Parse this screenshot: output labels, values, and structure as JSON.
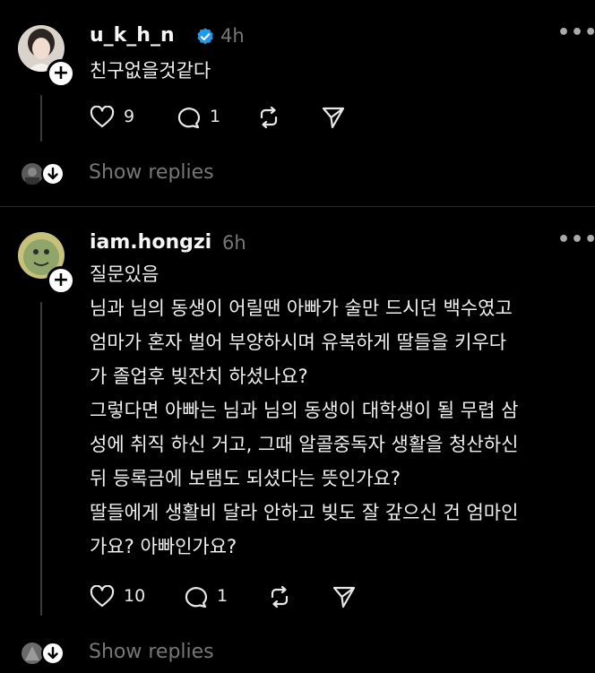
{
  "comments": [
    {
      "username": "u_k_h_n",
      "verified": true,
      "time": "4h",
      "lines": [
        "친구없을것같다"
      ],
      "likes": "9",
      "replies": "1",
      "show_replies": "Show replies"
    },
    {
      "username": "iam.hongzi",
      "verified": false,
      "time": "6h",
      "lines": [
        "질문있음",
        "님과 님의 동생이 어릴땐 아빠가 술만 드시던 백수였고",
        "엄마가 혼자 벌어 부양하시며 유복하게 딸들을 키우다",
        "가 졸업후 빚잔치 하셨나요?",
        "그렇다면 아빠는 님과 님의 동생이 대학생이 될 무렵 삼",
        "성에 취직 하신 거고, 그때 알콜중독자 생활을 청산하신",
        "뒤 등록금에 보탬도 되셨다는 뜻인가요?",
        "딸들에게 생활비 달라 안하고 빚도 잘 갚으신 건 엄마인",
        "가요? 아빠인가요?"
      ],
      "likes": "10",
      "replies": "1",
      "show_replies": "Show replies"
    }
  ],
  "icons": {
    "more": "more-options-icon",
    "like": "heart-icon",
    "reply": "comment-icon",
    "repost": "repost-icon",
    "share": "send-icon",
    "verified": "verified-badge-icon",
    "follow": "plus-icon",
    "expand": "arrow-down-icon"
  },
  "colors": {
    "background": "#000000",
    "verified": "#1d9bf0",
    "muted_text": "#777777"
  }
}
